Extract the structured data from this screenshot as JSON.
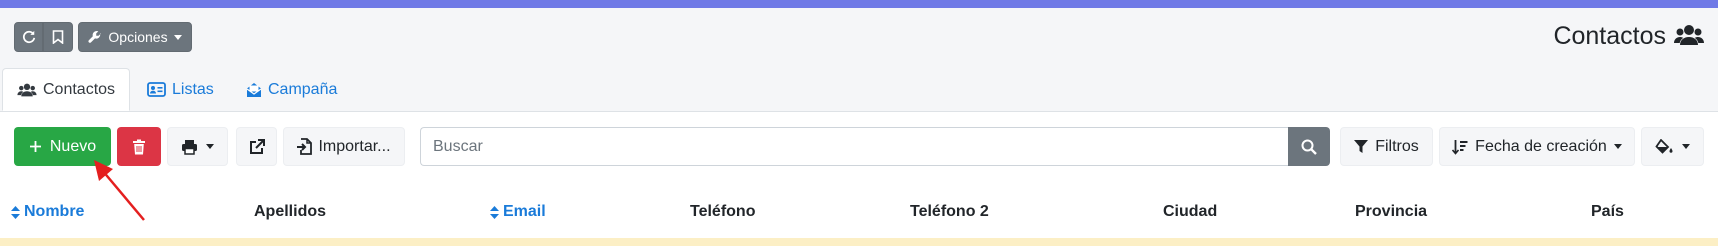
{
  "header": {
    "title": "Contactos",
    "options_label": "Opciones"
  },
  "tabs": [
    {
      "label": "Contactos",
      "icon": "users-icon",
      "active": true
    },
    {
      "label": "Listas",
      "icon": "address-card-icon",
      "active": false
    },
    {
      "label": "Campaña",
      "icon": "envelope-open-icon",
      "active": false
    }
  ],
  "toolbar": {
    "new_label": "Nuevo",
    "import_label": "Importar...",
    "search_placeholder": "Buscar",
    "filters_label": "Filtros",
    "sort_label": "Fecha de creación"
  },
  "table": {
    "columns": [
      {
        "label": "Nombre",
        "sortable": true
      },
      {
        "label": "Apellidos",
        "sortable": false
      },
      {
        "label": "Email",
        "sortable": true
      },
      {
        "label": "Teléfono",
        "sortable": false
      },
      {
        "label": "Teléfono 2",
        "sortable": false
      },
      {
        "label": "Ciudad",
        "sortable": false
      },
      {
        "label": "Provincia",
        "sortable": false
      },
      {
        "label": "País",
        "sortable": false
      }
    ]
  },
  "colors": {
    "accent_bar": "#6f79e6",
    "primary_success": "#28a745",
    "danger": "#dc3545",
    "link": "#1a7bd9",
    "row_highlight": "#fcefc5"
  }
}
